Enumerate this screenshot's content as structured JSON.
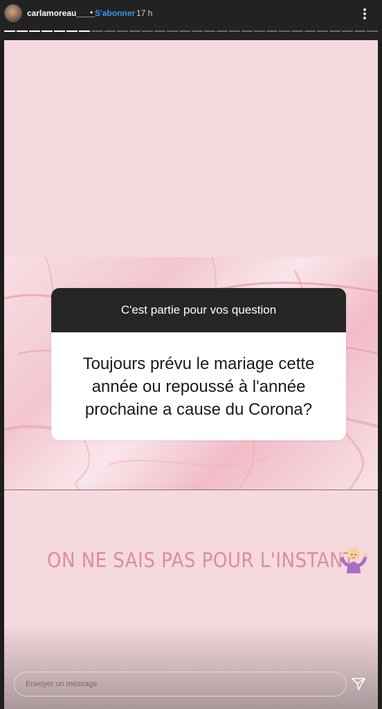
{
  "header": {
    "username": "carlamoreau____",
    "separator": "•",
    "follow_label": "S'abonner",
    "time": "17 h",
    "more_icon": "more-vertical-icon"
  },
  "progress": {
    "segments_total": 30,
    "segments_seen": 7
  },
  "question_sticker": {
    "title": "C'est partie pour vos question",
    "question": "Toujours prévu le mariage cette année ou repoussé à l'année prochaine a cause du Corona?"
  },
  "answer": {
    "text": "ON NE SAIS PAS POUR L'INSTANT",
    "emoji": "person-shrugging-icon"
  },
  "composer": {
    "placeholder": "Envoyer un message",
    "send_icon": "send-icon"
  },
  "colors": {
    "story_background": "#f5d9de",
    "answer_text": "#d98f9a",
    "follow_link": "#3897f0",
    "sticker_header": "#262626"
  }
}
